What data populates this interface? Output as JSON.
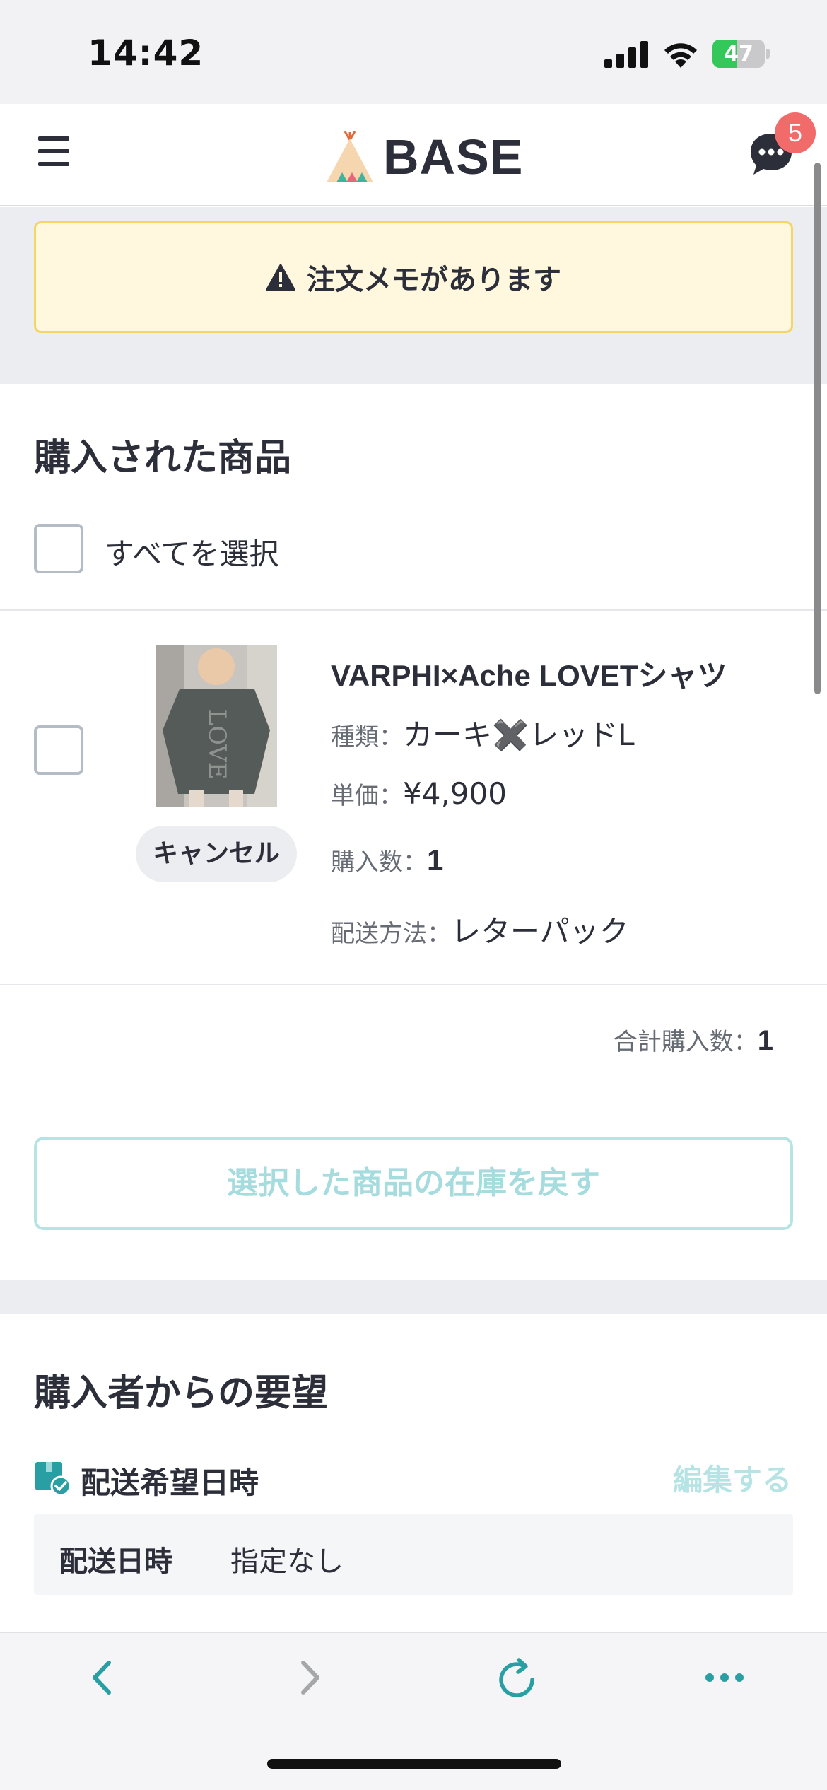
{
  "status_bar": {
    "time": "14:42",
    "battery_level": "47",
    "battery_fraction": 0.47
  },
  "header": {
    "logo_text": "BASE",
    "chat_badge_count": "5"
  },
  "memo_alert": {
    "text": "注文メモがあります"
  },
  "purchased": {
    "title": "購入された商品",
    "select_all_label": "すべてを選択",
    "items": [
      {
        "name": "VARPHI×Ache LOVETシャツ",
        "cancel_label": "キャンセル",
        "type_label": "種類：",
        "type_value": "カーキ✖️レッドL",
        "price_label": "単価：",
        "price_value": "¥4,900",
        "qty_label": "購入数：",
        "qty_value": "1",
        "shipping_label": "配送方法：",
        "shipping_value": "レターパック"
      }
    ],
    "total_label": "合計購入数：",
    "total_value": "1",
    "restore_button": "選択した商品の在庫を戻す"
  },
  "requests": {
    "title": "購入者からの要望",
    "delivery_label": "配送希望日時",
    "edit_label": "編集する",
    "delivery_key": "配送日時",
    "delivery_value": "指定なし"
  },
  "colors": {
    "accent_teal": "#2a9fa3",
    "alert_bg": "#fff8df",
    "alert_border": "#f5d565",
    "badge_red": "#f26b6b",
    "battery_green": "#34c759"
  },
  "icons": {
    "menu": "hamburger-icon",
    "chat": "chat-bubble-icon",
    "warning": "warning-icon",
    "delivery": "delivery-box-icon",
    "back": "chevron-left-icon",
    "forward": "chevron-right-icon",
    "reload": "reload-icon",
    "more": "more-icon"
  }
}
